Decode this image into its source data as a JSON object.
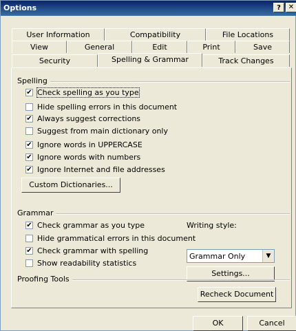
{
  "window": {
    "title": "Options",
    "help_glyph": "?",
    "close_glyph": "✕"
  },
  "tabs": {
    "row1": [
      "User Information",
      "Compatibility",
      "File Locations"
    ],
    "row2": [
      "View",
      "General",
      "Edit",
      "Print",
      "Save"
    ],
    "row3": [
      "Security",
      "Spelling & Grammar",
      "Track Changes"
    ],
    "active": "Spelling & Grammar"
  },
  "spelling": {
    "label": "Spelling",
    "options": [
      {
        "label": "Check spelling as you type",
        "checked": true
      },
      {
        "label": "Hide spelling errors in this document",
        "checked": false
      },
      {
        "label": "Always suggest corrections",
        "checked": true
      },
      {
        "label": "Suggest from main dictionary only",
        "checked": false
      },
      {
        "label": "Ignore words in UPPERCASE",
        "checked": true
      },
      {
        "label": "Ignore words with numbers",
        "checked": true
      },
      {
        "label": "Ignore Internet and file addresses",
        "checked": true
      }
    ],
    "custom_dictionaries_button": "Custom Dictionaries..."
  },
  "grammar": {
    "label": "Grammar",
    "options": [
      {
        "label": "Check grammar as you type",
        "checked": true
      },
      {
        "label": "Hide grammatical errors in this document",
        "checked": false
      },
      {
        "label": "Check grammar with spelling",
        "checked": true
      },
      {
        "label": "Show readability statistics",
        "checked": false
      }
    ],
    "writing_style_label": "Writing style:",
    "writing_style_value": "Grammar Only",
    "settings_button": "Settings..."
  },
  "proofing": {
    "label": "Proofing Tools",
    "recheck_button": "Recheck Document"
  },
  "footer": {
    "ok_button": "OK",
    "cancel_button": "Cancel"
  }
}
